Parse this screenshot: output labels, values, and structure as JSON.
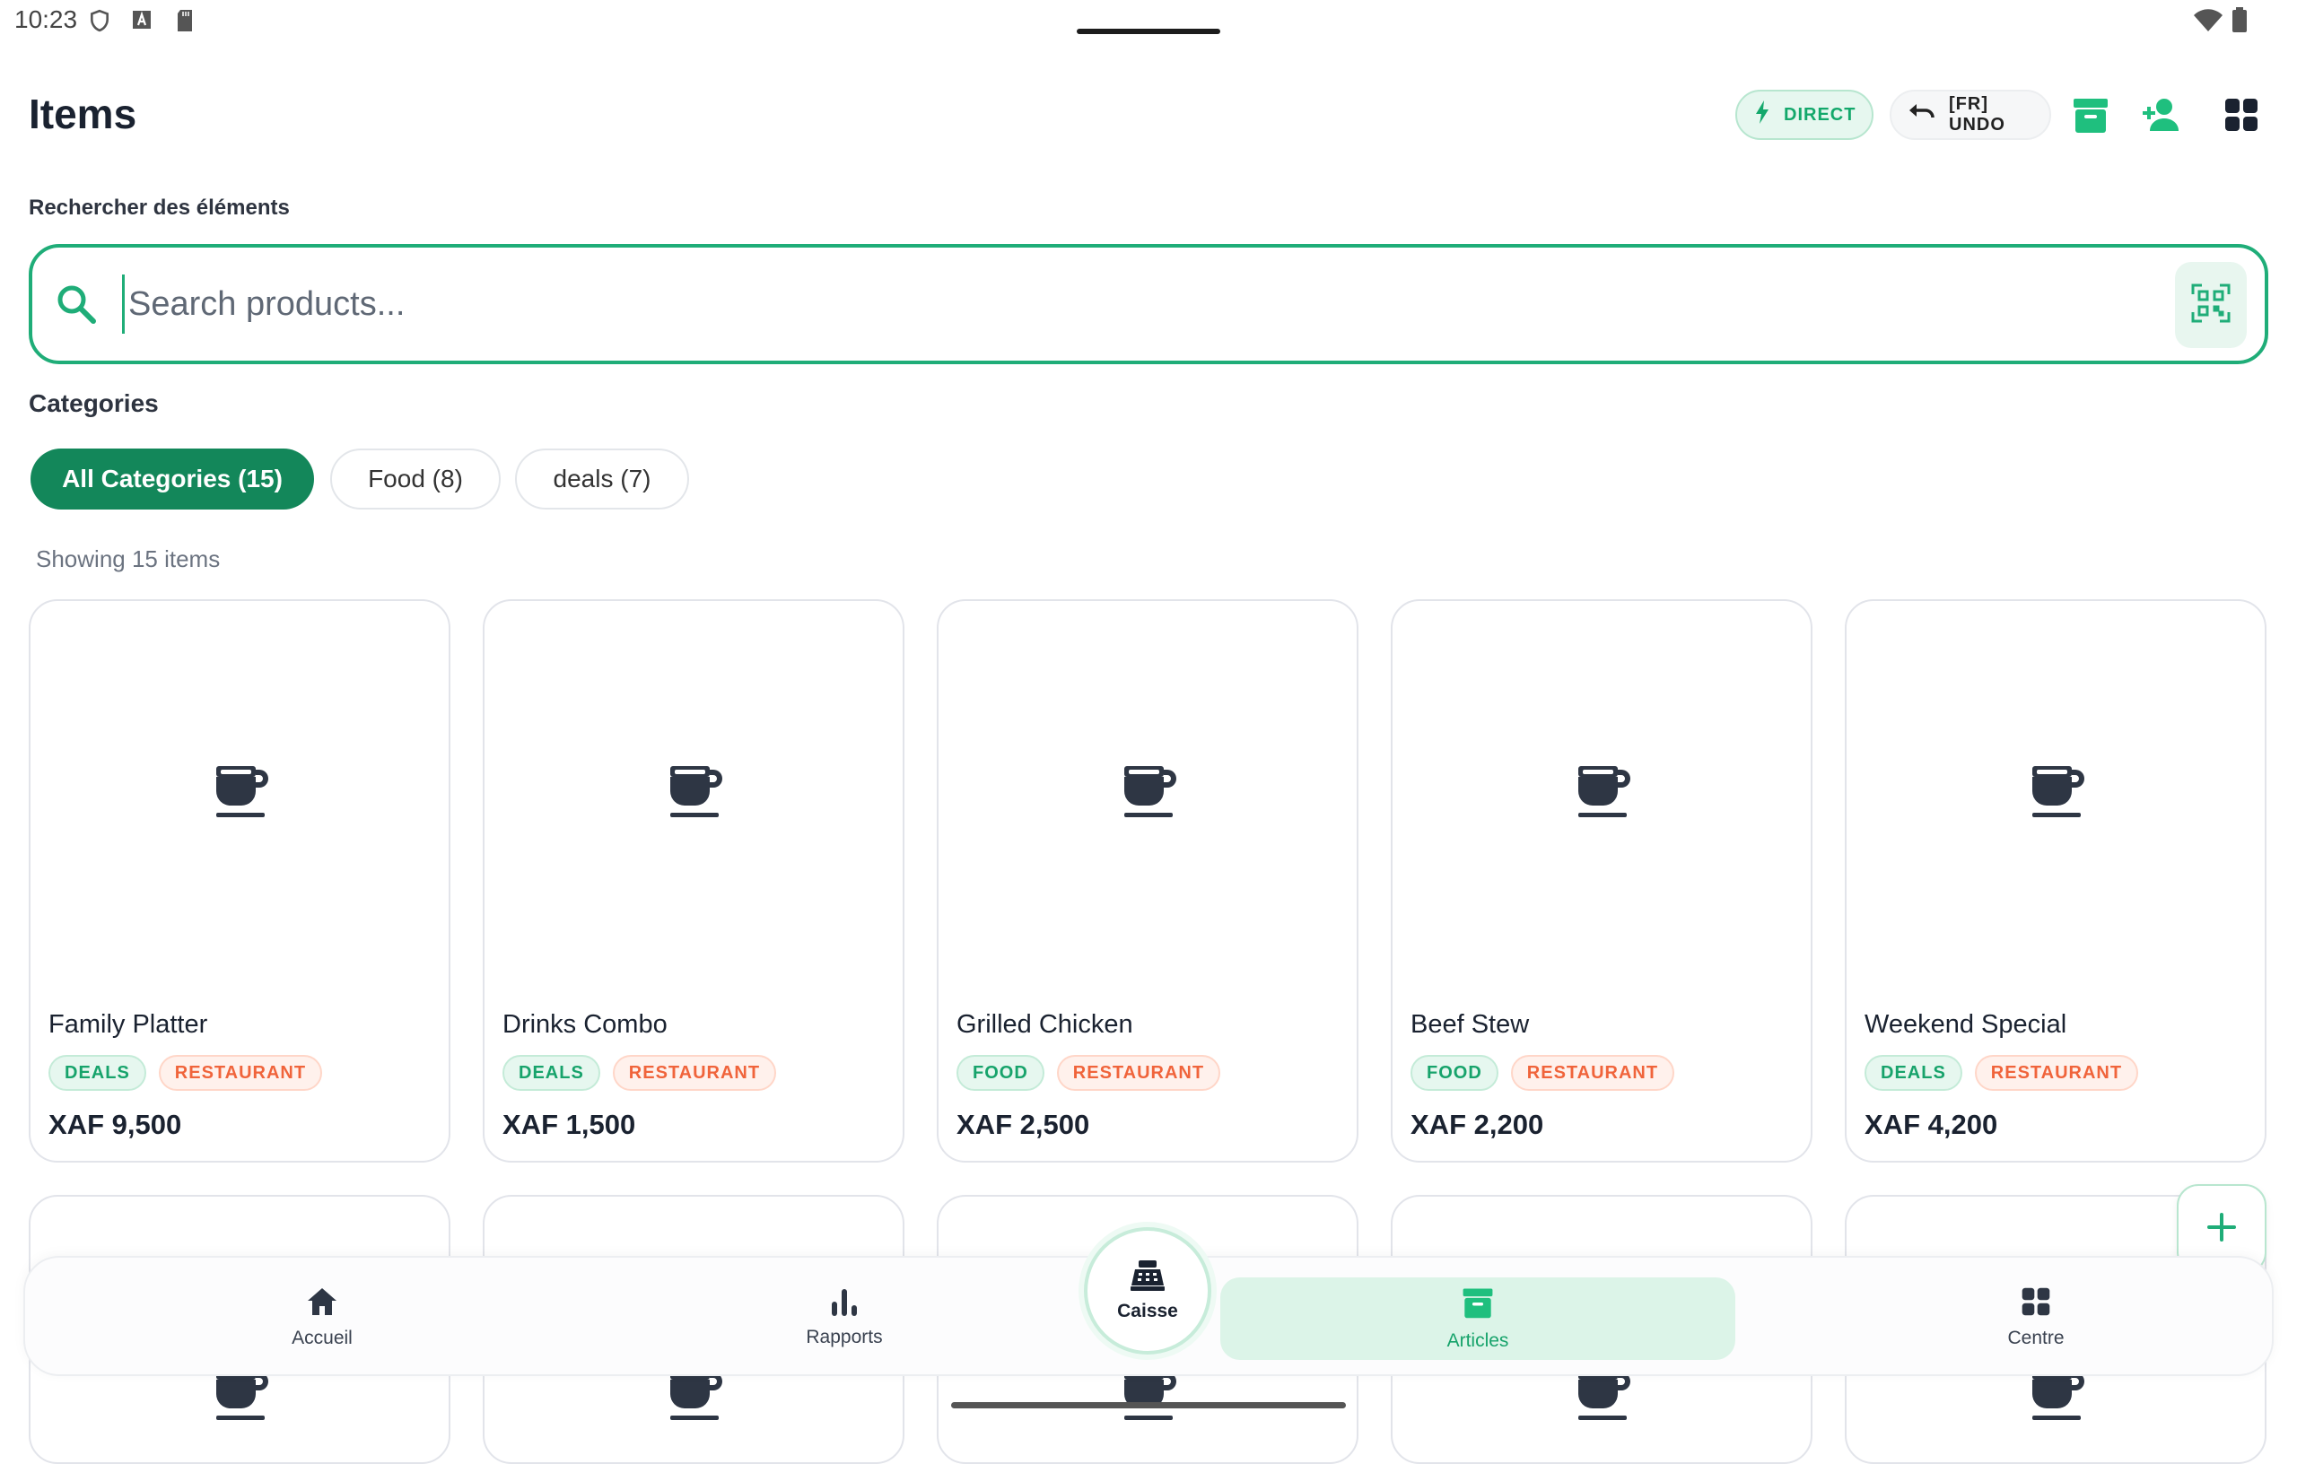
{
  "status": {
    "time": "10:23"
  },
  "header": {
    "title": "Items",
    "direct_label": "DIRECT",
    "undo_label": "[FR] UNDO"
  },
  "search": {
    "label": "Rechercher des éléments",
    "placeholder": "Search products...",
    "value": ""
  },
  "categories": {
    "label": "Categories",
    "chips": [
      "All Categories (15)",
      "Food (8)",
      "deals (7)"
    ],
    "active_index": 0
  },
  "results": {
    "showing": "Showing 15 items"
  },
  "products": [
    {
      "name": "Family Platter",
      "tags": [
        "DEALS",
        "RESTAURANT"
      ],
      "price": "XAF 9,500"
    },
    {
      "name": "Drinks Combo",
      "tags": [
        "DEALS",
        "RESTAURANT"
      ],
      "price": "XAF 1,500"
    },
    {
      "name": "Grilled Chicken",
      "tags": [
        "FOOD",
        "RESTAURANT"
      ],
      "price": "XAF 2,500"
    },
    {
      "name": "Beef Stew",
      "tags": [
        "FOOD",
        "RESTAURANT"
      ],
      "price": "XAF 2,200"
    },
    {
      "name": "Weekend Special",
      "tags": [
        "DEALS",
        "RESTAURANT"
      ],
      "price": "XAF 4,200"
    }
  ],
  "bottom_nav": {
    "items": [
      "Accueil",
      "Rapports",
      "Caisse",
      "Articles",
      "Centre"
    ],
    "active": "Articles"
  },
  "colors": {
    "accent": "#13875a",
    "accent_light": "#1fad78",
    "tag_orange": "#f0643b"
  },
  "icons": [
    "shield-icon",
    "font-icon",
    "sd-card-icon",
    "wifi-icon",
    "battery-icon",
    "bolt-icon",
    "undo-icon",
    "archive-icon",
    "add-person-icon",
    "grid-icon",
    "search-icon",
    "qr-scan-icon",
    "coffee-cup-icon",
    "plus-icon",
    "home-icon",
    "bar-chart-icon",
    "cash-register-icon"
  ]
}
